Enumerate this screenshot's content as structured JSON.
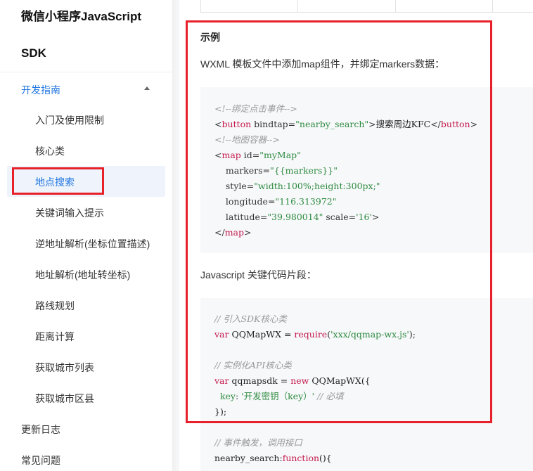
{
  "sidebar": {
    "title_line1": "微信小程序JavaScript",
    "title_line2": "SDK",
    "section": "开发指南",
    "items": [
      "入门及使用限制",
      "核心类",
      "地点搜索",
      "关键词输入提示",
      "逆地址解析(坐标位置描述)",
      "地址解析(地址转坐标)",
      "路线规划",
      "距离计算",
      "获取城市列表",
      "获取城市区县"
    ],
    "bottom": [
      "更新日志",
      "常见问题"
    ]
  },
  "main": {
    "heading": "示例",
    "wxml_intro": "WXML 模板文件中添加map组件，并绑定markers数据：",
    "js_intro": "Javascript 关键代码片段：",
    "wxml_code": {
      "c1": "<!--绑定点击事件-->",
      "l2_open": "<",
      "l2_tag": "button",
      "l2_attr": " bindtap=",
      "l2_val": "\"nearby_search\"",
      "l2_close": ">",
      "l2_text": "搜索周边KFC",
      "l2_end_open": "</",
      "l2_end_tag": "button",
      "l2_end_close": ">",
      "c3": "<!--地图容器-->",
      "l4_open": "<",
      "l4_tag": "map",
      "l4_attr": " id=",
      "l4_val": "\"myMap\"",
      "l5_attr": "    markers=",
      "l5_val": "\"{{markers}}\"",
      "l6_attr": "    style=",
      "l6_val": "\"width:100%;height:300px;\"",
      "l7_attr": "    longitude=",
      "l7_val": "\"116.313972\"",
      "l8_attr": "    latitude=",
      "l8_val": "\"39.980014\"",
      "l8_attr2": " scale=",
      "l8_val2": "'16'",
      "l8_close": ">",
      "l9_open": "</",
      "l9_tag": "map",
      "l9_close": ">"
    },
    "js_code": {
      "c1": "// 引入SDK核心类",
      "l2_kw": "var",
      "l2_txt": " QQMapWX = ",
      "l2_fn": "require",
      "l2_p1": "(",
      "l2_str": "'xxx/qqmap-wx.js'",
      "l2_p2": ");",
      "c3": "// 实例化API核心类",
      "l4_kw": "var",
      "l4_txt": " qqmapsdk = ",
      "l4_new": "new",
      "l4_txt2": " QQMapWX({",
      "l5_key": "  key",
      "l5_colon": ": ",
      "l5_str": "'开发密钥（key）'",
      "l5_cm": " // 必填",
      "l6": "});",
      "c7": "// 事件触发，调用接口",
      "l8_txt": "nearby_search:",
      "l8_fn": "function",
      "l8_txt2": "(){"
    }
  }
}
